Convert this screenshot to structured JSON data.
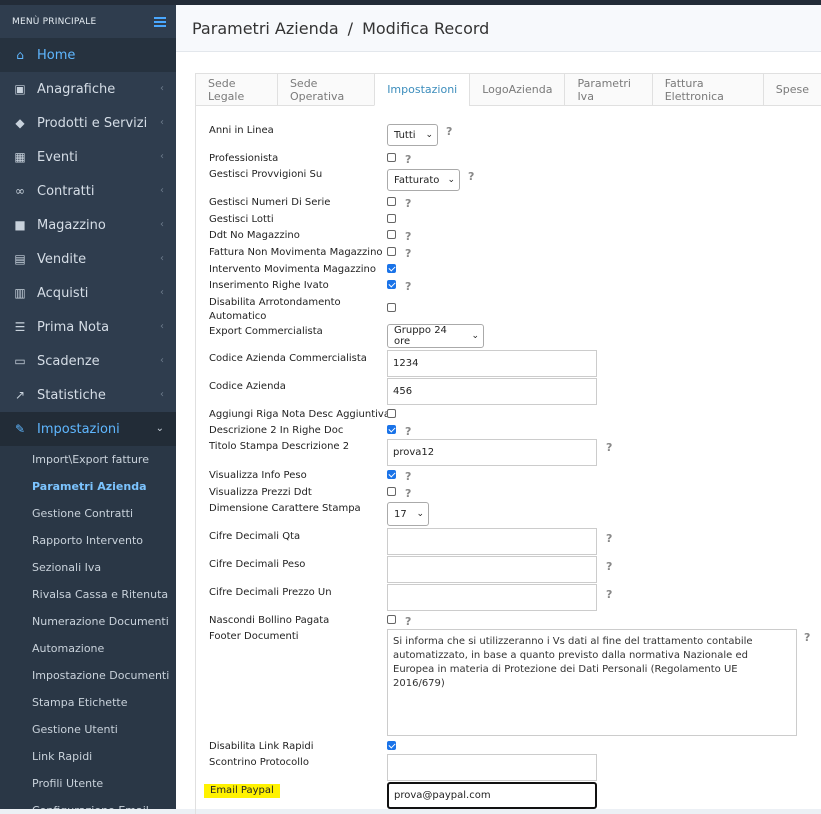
{
  "sidebar": {
    "title": "MENÙ PRINCIPALE",
    "items": [
      {
        "label": "Home",
        "icon": "home-icon"
      },
      {
        "label": "Anagrafiche",
        "icon": "address-card-icon"
      },
      {
        "label": "Prodotti e Servizi",
        "icon": "tag-icon"
      },
      {
        "label": "Eventi",
        "icon": "calendar-check-icon"
      },
      {
        "label": "Contratti",
        "icon": "handshake-icon"
      },
      {
        "label": "Magazzino",
        "icon": "truck-icon"
      },
      {
        "label": "Vendite",
        "icon": "basket-icon"
      },
      {
        "label": "Acquisti",
        "icon": "barcode-icon"
      },
      {
        "label": "Prima Nota",
        "icon": "list-icon"
      },
      {
        "label": "Scadenze",
        "icon": "money-icon"
      },
      {
        "label": "Statistiche",
        "icon": "chart-line-icon"
      },
      {
        "label": "Impostazioni",
        "icon": "wrench-icon"
      }
    ],
    "sub_items": [
      "Import\\Export fatture",
      "Parametri Azienda",
      "Gestione Contratti",
      "Rapporto Intervento",
      "Sezionali Iva",
      "Rivalsa Cassa e Ritenuta",
      "Numerazione Documenti",
      "Automazione",
      "Impostazione Documenti",
      "Stampa Etichette",
      "Gestione Utenti",
      "Link Rapidi",
      "Profili Utente",
      "Configurazione Email"
    ]
  },
  "header": {
    "part1": "Parametri Azienda",
    "sep": "/",
    "part2": "Modifica Record"
  },
  "tabs": [
    "Sede Legale",
    "Sede Operativa",
    "Impostazioni",
    "LogoAzienda",
    "Parametri Iva",
    "Fattura Elettronica",
    "Spese"
  ],
  "form": {
    "anni_in_linea": {
      "label": "Anni in Linea",
      "value": "Tutti"
    },
    "professionista": {
      "label": "Professionista"
    },
    "gestisci_provvigioni": {
      "label": "Gestisci Provvigioni Su",
      "value": "Fatturato"
    },
    "gestisci_numeri_serie": {
      "label": "Gestisci Numeri Di Serie"
    },
    "gestisci_lotti": {
      "label": "Gestisci Lotti"
    },
    "ddt_no_magazzino": {
      "label": "Ddt No Magazzino"
    },
    "fattura_non_movimenta": {
      "label": "Fattura Non Movimenta Magazzino"
    },
    "intervento_movimenta": {
      "label": "Intervento Movimenta Magazzino"
    },
    "inserimento_righe_ivato": {
      "label": "Inserimento Righe Ivato"
    },
    "disabilita_arrotondamento": {
      "label1": "Disabilita Arrotondamento",
      "label2": "Automatico"
    },
    "export_commercialista": {
      "label": "Export Commercialista",
      "value": "Gruppo 24 ore"
    },
    "codice_azienda_commercialista": {
      "label": "Codice Azienda Commercialista",
      "value": "1234"
    },
    "codice_azienda": {
      "label": "Codice Azienda",
      "value": "456"
    },
    "aggiungi_riga_nota": {
      "label": "Aggiungi Riga Nota Desc Aggiuntiva"
    },
    "descrizione2_righe": {
      "label": "Descrizione 2 In Righe Doc"
    },
    "titolo_stampa_desc2": {
      "label": "Titolo Stampa Descrizione 2",
      "value": "prova12"
    },
    "visualizza_info_peso": {
      "label": "Visualizza Info Peso"
    },
    "visualizza_prezzi_ddt": {
      "label": "Visualizza Prezzi Ddt"
    },
    "dimensione_carattere": {
      "label": "Dimensione Carattere Stampa",
      "value": "17"
    },
    "cifre_decimali_qta": {
      "label": "Cifre Decimali Qta",
      "value": ""
    },
    "cifre_decimali_peso": {
      "label": "Cifre Decimali Peso",
      "value": ""
    },
    "cifre_decimali_prezzo": {
      "label": "Cifre Decimali Prezzo Un",
      "value": ""
    },
    "nascondi_bollino": {
      "label": "Nascondi Bollino Pagata"
    },
    "footer_documenti": {
      "label": "Footer Documenti",
      "value": "Si informa che si utilizzeranno i Vs dati al fine del trattamento contabile automatizzato, in base a quanto previsto dalla normativa Nazionale ed Europea in materia di Protezione dei Dati Personali (Regolamento UE 2016/679)"
    },
    "disabilita_link_rapidi": {
      "label": "Disabilita Link Rapidi"
    },
    "scontrino_protocollo": {
      "label": "Scontrino Protocollo",
      "value": ""
    },
    "email_paypal": {
      "label": "Email Paypal",
      "value": "prova@paypal.com"
    }
  },
  "help_glyph": "?",
  "colors": {
    "sidebar_bg": "#2f3d4e",
    "accent": "#3c8dbc",
    "highlight": "#fff200"
  }
}
